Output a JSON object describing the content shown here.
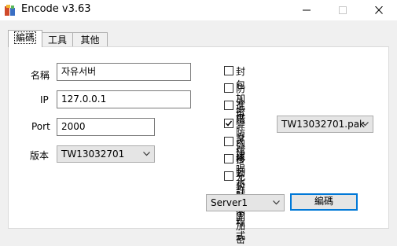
{
  "window": {
    "title": "Encode v3.63"
  },
  "tabs": [
    {
      "label": "編碼"
    },
    {
      "label": "工具"
    },
    {
      "label": "其他"
    }
  ],
  "form": {
    "name_label": "名稱",
    "name_value": "자유서버",
    "ip_label": "IP",
    "ip_value": "127.0.0.1",
    "port_label": "Port",
    "port_value": "2000",
    "version_label": "版本",
    "version_value": "TW13032701"
  },
  "options": [
    {
      "label": "封包加密",
      "checked": false
    },
    {
      "label": "防外掛",
      "checked": false
    },
    {
      "label": "進階防外掛",
      "checked": false
    },
    {
      "label": "變身檔",
      "checked": true
    },
    {
      "label": "內建喝水輔助程式",
      "checked": false
    },
    {
      "label": "移動封包不加密",
      "checked": false
    },
    {
      "label": "允許多開",
      "checked": false
    }
  ],
  "morph_file": {
    "value": "TW13032701.pak"
  },
  "server_select": {
    "value": "Server1"
  },
  "encode_button": {
    "label": "編碼"
  },
  "colors": {
    "accent": "#0078d7",
    "panel": "#ffffff",
    "window": "#f0f0f0"
  }
}
